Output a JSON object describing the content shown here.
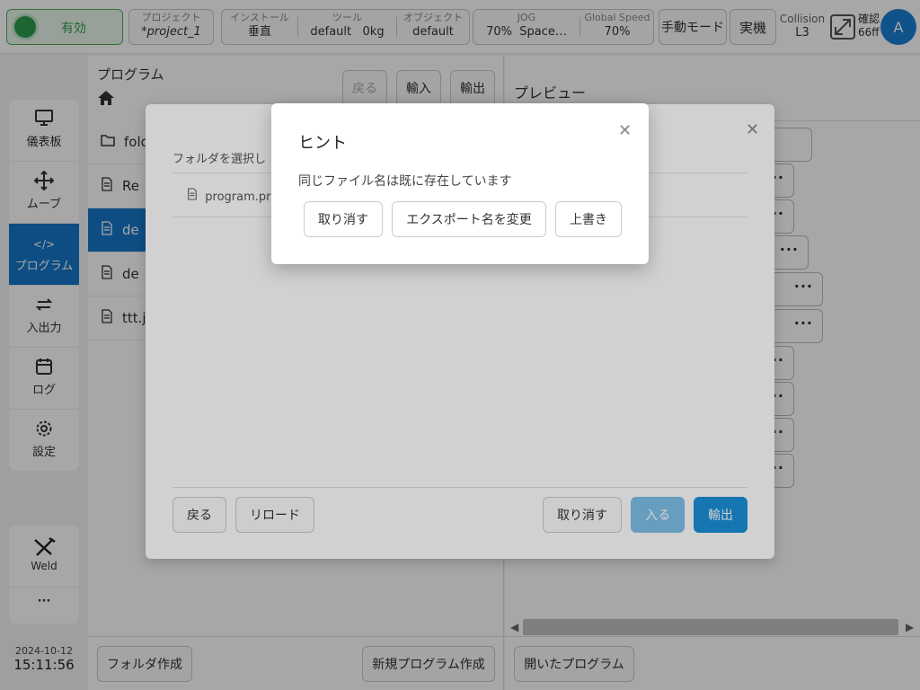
{
  "topbar": {
    "state": "有効",
    "project_label": "プロジェクト",
    "project_value": "*project_1",
    "install_label": "インストール",
    "install_value": "垂直",
    "tool_label": "ツール",
    "tool_value": "default",
    "tool_weight": "0kg",
    "object_label": "オブジェクト",
    "object_value": "default",
    "jog_label": "JOG",
    "jog_value": "70%",
    "jog_space": "Space…",
    "speed_label": "Global Speed",
    "speed_value": "70%",
    "mode_button": "手動モード",
    "real_button": "実機",
    "collision_label": "Collision",
    "collision_value": "L3",
    "confirm_label": "確認",
    "confirm_value": "66ff",
    "avatar": "A"
  },
  "nav": {
    "items": [
      {
        "label": "儀表板",
        "icon": "monitor-icon"
      },
      {
        "label": "ムーブ",
        "icon": "move-icon"
      },
      {
        "label": "プログラム",
        "icon": "code-icon"
      },
      {
        "label": "入出力",
        "icon": "io-icon"
      },
      {
        "label": "ログ",
        "icon": "calendar-icon"
      },
      {
        "label": "設定",
        "icon": "gear-icon"
      }
    ],
    "weld": "Weld",
    "more": "···"
  },
  "clock": {
    "date": "2024-10-12",
    "time": "15:11:56"
  },
  "program": {
    "title": "プログラム",
    "back": "戻る",
    "import": "輸入",
    "export": "輸出",
    "files": [
      "fold",
      "Re",
      "de",
      "de",
      "ttt.js"
    ],
    "new_folder": "フォルダ作成",
    "new_program": "新規プログラム作成"
  },
  "preview": {
    "title": "プレビュー",
    "opened": "開いたプログラム",
    "node_menu": "···"
  },
  "export_dialog": {
    "select_label": "フォルダを選択し",
    "file": "program.pr",
    "back": "戻る",
    "reload": "リロード",
    "cancel": "取り消す",
    "enter": "入る",
    "export": "輸出"
  },
  "hint_dialog": {
    "title": "ヒント",
    "message": "同じファイル名は既に存在しています",
    "cancel": "取り消す",
    "rename": "エクスポート名を変更",
    "overwrite": "上書き"
  }
}
